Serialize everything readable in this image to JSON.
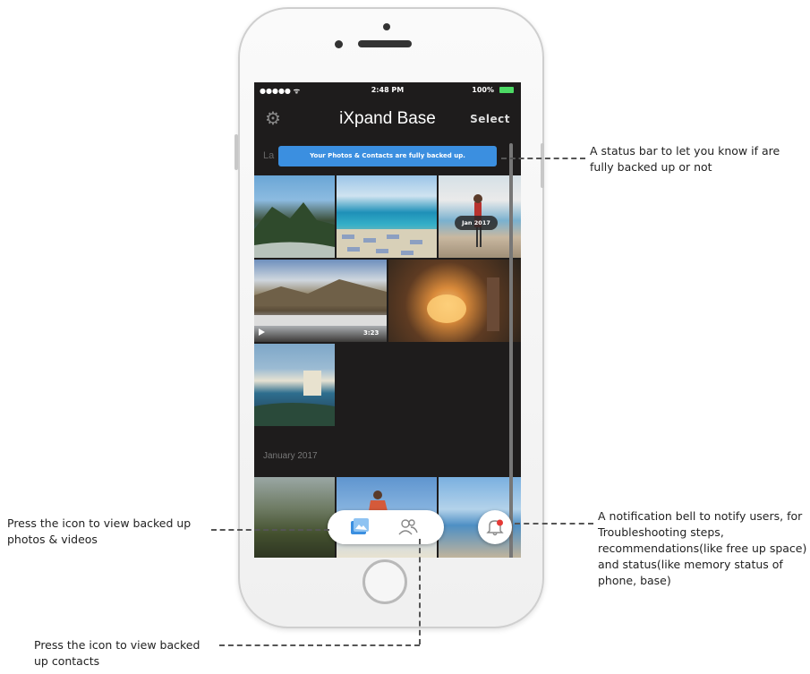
{
  "status_bar": {
    "signal": "●●●●● ᯤ",
    "time": "2:48 PM",
    "battery": "100%"
  },
  "navbar": {
    "title": "iXpand Base",
    "select_label": "Select",
    "settings_icon": "gear-icon"
  },
  "section_cut_label": "La",
  "backup_banner": "Your Photos & Contacts are fully backed up.",
  "photo_overlays": {
    "date_badge": "Jan 2017",
    "video_duration": "3:23"
  },
  "section_label": "January 2017",
  "tabbar": {
    "photos_icon": "photo-gallery-icon",
    "contacts_icon": "contacts-icon",
    "bell_icon": "notification-bell-icon"
  },
  "colors": {
    "banner": "#3b8fe0",
    "active_tab": "#3b8fe0",
    "bell_badge": "#e53935",
    "screen_bg": "#1e1c1c"
  },
  "annotations": {
    "status_bar_callout": "A status bar to let you know if are fully backed up or not",
    "bell_callout": "A notification bell to notify users, for Troubleshooting steps, recommendations(like free up space) and status(like memory status of phone, base)",
    "photos_callout": "Press the icon to view backed up photos & videos",
    "contacts_callout": "Press the icon to view backed up contacts"
  }
}
